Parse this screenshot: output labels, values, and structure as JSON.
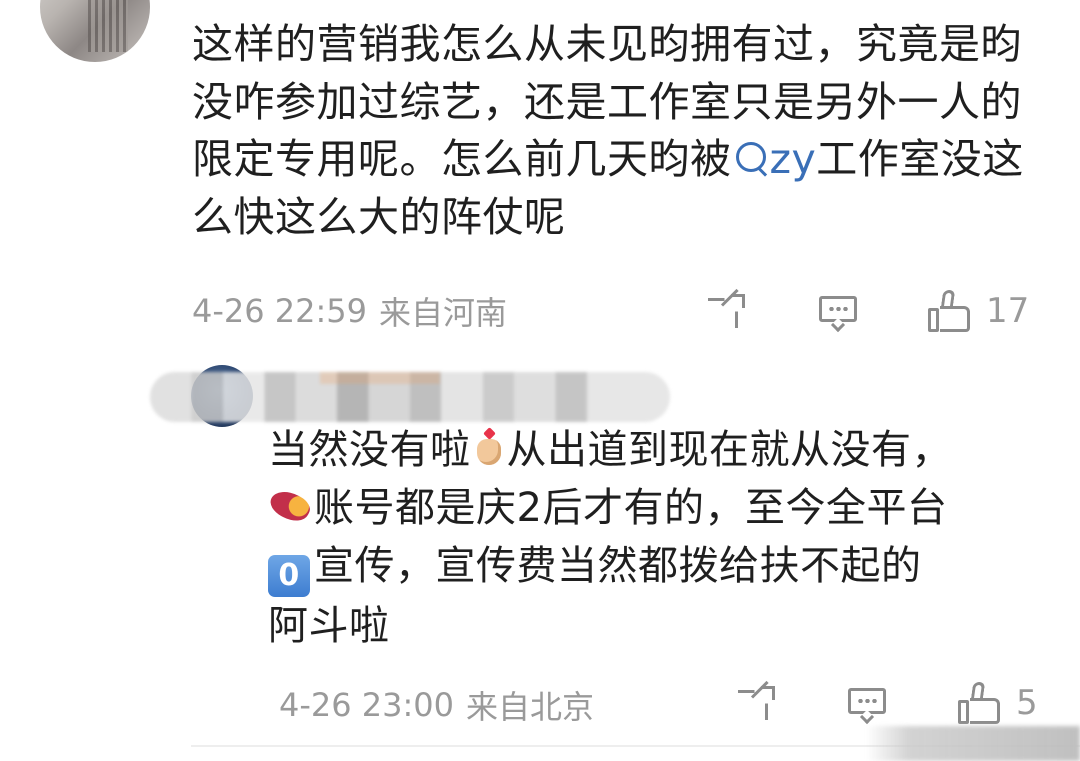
{
  "comment": {
    "text_before": "这样的营销我怎么从未见昀拥有过，究竟是昀没咋参加过综艺，还是工作室只是另外一人的限定专用呢。怎么前几天昀被",
    "search_keyword": "zy",
    "text_after": "工作室没这么快这么大的阵仗呢",
    "timestamp": "4-26 22:59",
    "location": "来自河南",
    "like_count": "17"
  },
  "reply": {
    "line1_a": "当然没有啦",
    "line1_b": "从出道到现在就从没有，",
    "line2": "账号都是庆2后才有的，至今全平台",
    "zero_badge": "0",
    "line3": "宣传，宣传费当然都拨给扶不起的",
    "line4": "阿斗啦",
    "timestamp": "4-26 23:00",
    "location": "来自北京",
    "like_count": "5"
  },
  "icons": {
    "share": "share-icon",
    "comment": "comment-icon",
    "like": "like-icon",
    "search": "search-icon",
    "hand_heart": "finger-heart-emoji",
    "sweet_potato": "sweet-potato-emoji",
    "keycap_zero": "keycap-zero-emoji"
  },
  "colors": {
    "link": "#3a6fb7",
    "meta": "#9a9a9a",
    "text": "#1f1f1f"
  }
}
